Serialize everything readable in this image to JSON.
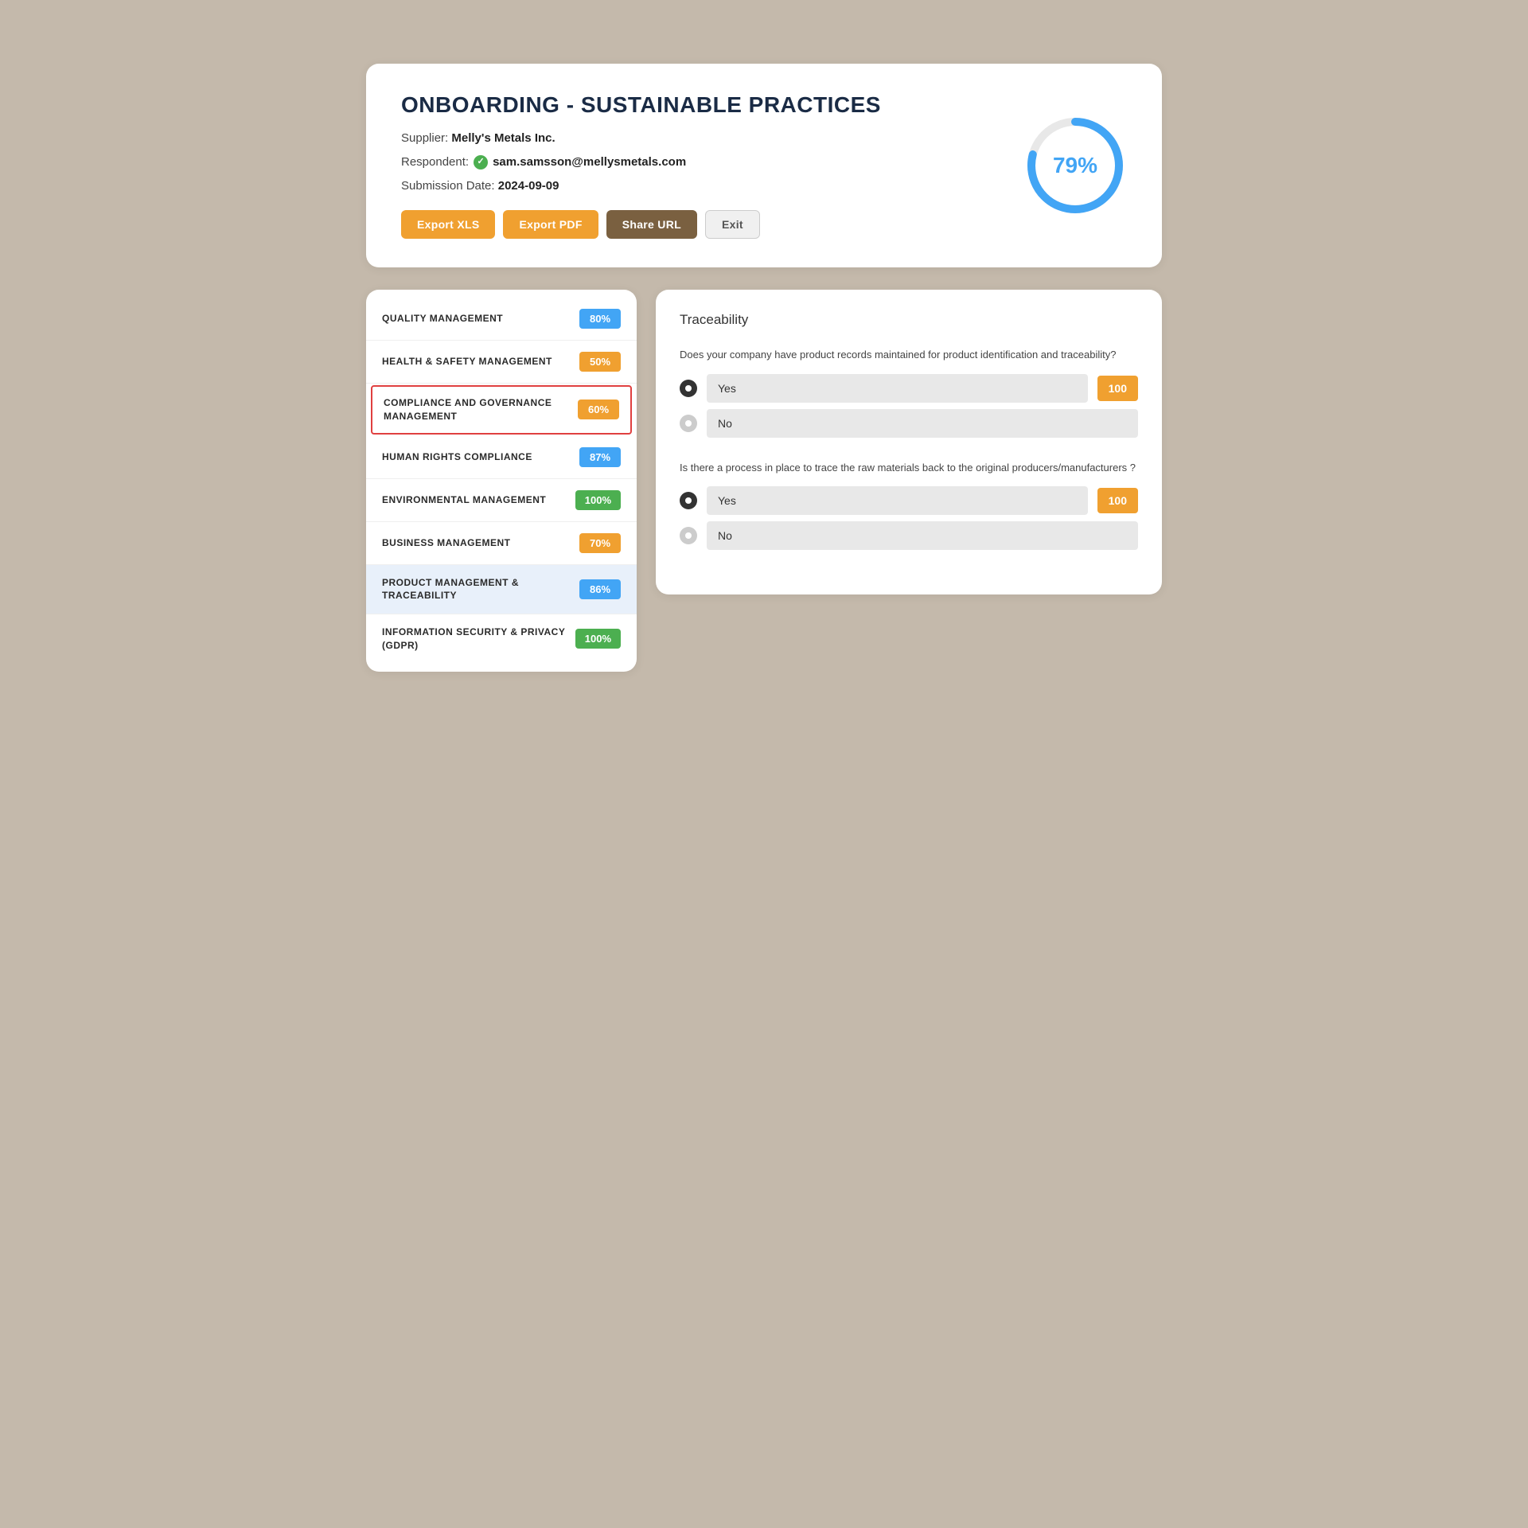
{
  "header": {
    "title": "ONBOARDING - SUSTAINABLE PRACTICES",
    "supplier_label": "Supplier:",
    "supplier_name": "Melly's Metals Inc.",
    "respondent_label": "Respondent:",
    "respondent_email": "sam.samsson@mellysmetals.com",
    "submission_label": "Submission Date:",
    "submission_date": "2024-09-09",
    "score_percent": "79%",
    "buttons": {
      "export_xls": "Export XLS",
      "export_pdf": "Export PDF",
      "share_url": "Share URL",
      "exit": "Exit"
    }
  },
  "categories": [
    {
      "label": "QUALITY MANAGEMENT",
      "score": "80%",
      "color": "blue",
      "selected": false,
      "highlighted": false
    },
    {
      "label": "HEALTH & SAFETY MANAGEMENT",
      "score": "50%",
      "color": "orange",
      "selected": false,
      "highlighted": false
    },
    {
      "label": "COMPLIANCE AND GOVERNANCE MANAGEMENT",
      "score": "60%",
      "color": "orange",
      "selected": true,
      "highlighted": false
    },
    {
      "label": "HUMAN RIGHTS COMPLIANCE",
      "score": "87%",
      "color": "blue",
      "selected": false,
      "highlighted": false
    },
    {
      "label": "ENVIRONMENTAL MANAGEMENT",
      "score": "100%",
      "color": "green",
      "selected": false,
      "highlighted": false
    },
    {
      "label": "BUSINESS MANAGEMENT",
      "score": "70%",
      "color": "orange",
      "selected": false,
      "highlighted": false
    },
    {
      "label": "PRODUCT MANAGEMENT & TRACEABILITY",
      "score": "86%",
      "color": "blue",
      "selected": false,
      "highlighted": true
    },
    {
      "label": "INFORMATION SECURITY & PRIVACY (GDPR)",
      "score": "100%",
      "color": "green",
      "selected": false,
      "highlighted": false
    }
  ],
  "detail": {
    "section_title": "Traceability",
    "questions": [
      {
        "text": "Does your company have product records maintained for product identification and traceability?",
        "options": [
          {
            "label": "Yes",
            "selected": true,
            "score": "100"
          },
          {
            "label": "No",
            "selected": false,
            "score": null
          }
        ]
      },
      {
        "text": "Is there a process in place to trace the raw materials back to the original producers/manufacturers ?",
        "options": [
          {
            "label": "Yes",
            "selected": true,
            "score": "100"
          },
          {
            "label": "No",
            "selected": false,
            "score": null
          }
        ]
      }
    ]
  }
}
